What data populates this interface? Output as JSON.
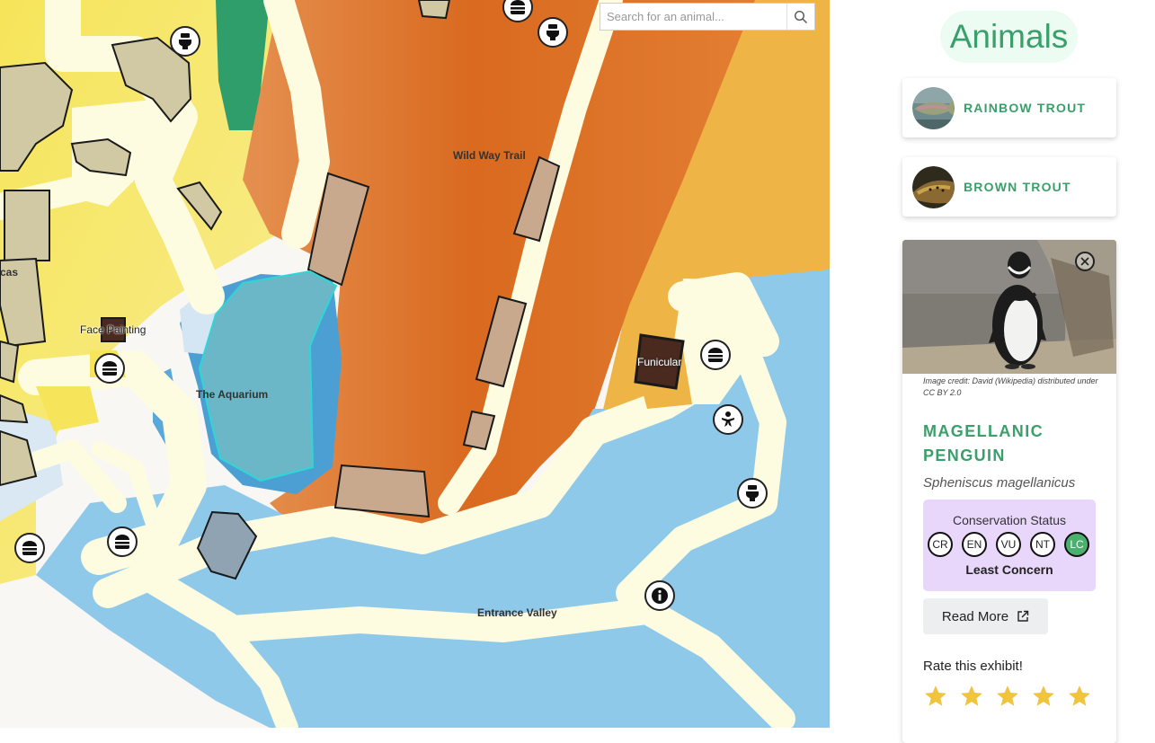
{
  "search": {
    "placeholder": "Search for an animal..."
  },
  "map": {
    "labels": {
      "wild_way_trail": "Wild Way Trail",
      "the_aquarium": "The Aquarium",
      "entrance_valley": "Entrance Valley",
      "face_painting": "Face Painting",
      "funicular": "Funicular",
      "partial_cas": "cas"
    }
  },
  "panel": {
    "title": "Animals",
    "animals": [
      {
        "name": "RAINBOW TROUT"
      },
      {
        "name": "BROWN TROUT"
      }
    ],
    "detail": {
      "image_credit": "Image credit: David (Wikipedia) distributed under CC BY 2.0",
      "common_name": "MAGELLANIC PENGUIN",
      "scientific_name": "Spheniscus magellanicus",
      "conservation": {
        "label": "Conservation Status",
        "codes": [
          "CR",
          "EN",
          "VU",
          "NT",
          "LC"
        ],
        "active": "LC",
        "status": "Least Concern"
      },
      "read_more": "Read More",
      "rate_label": "Rate this exhibit!",
      "rating": {
        "value": 5,
        "max": 5
      }
    }
  },
  "colors": {
    "accent_green": "#3a9f6a",
    "title_bg": "#ecfcf2",
    "conservation_bg": "#e8d7fb",
    "active_status": "#4ab06e",
    "star": "#f0c43c",
    "water": "#8ec9ea",
    "orange": "#e07a33",
    "path": "#fdfbe0"
  }
}
